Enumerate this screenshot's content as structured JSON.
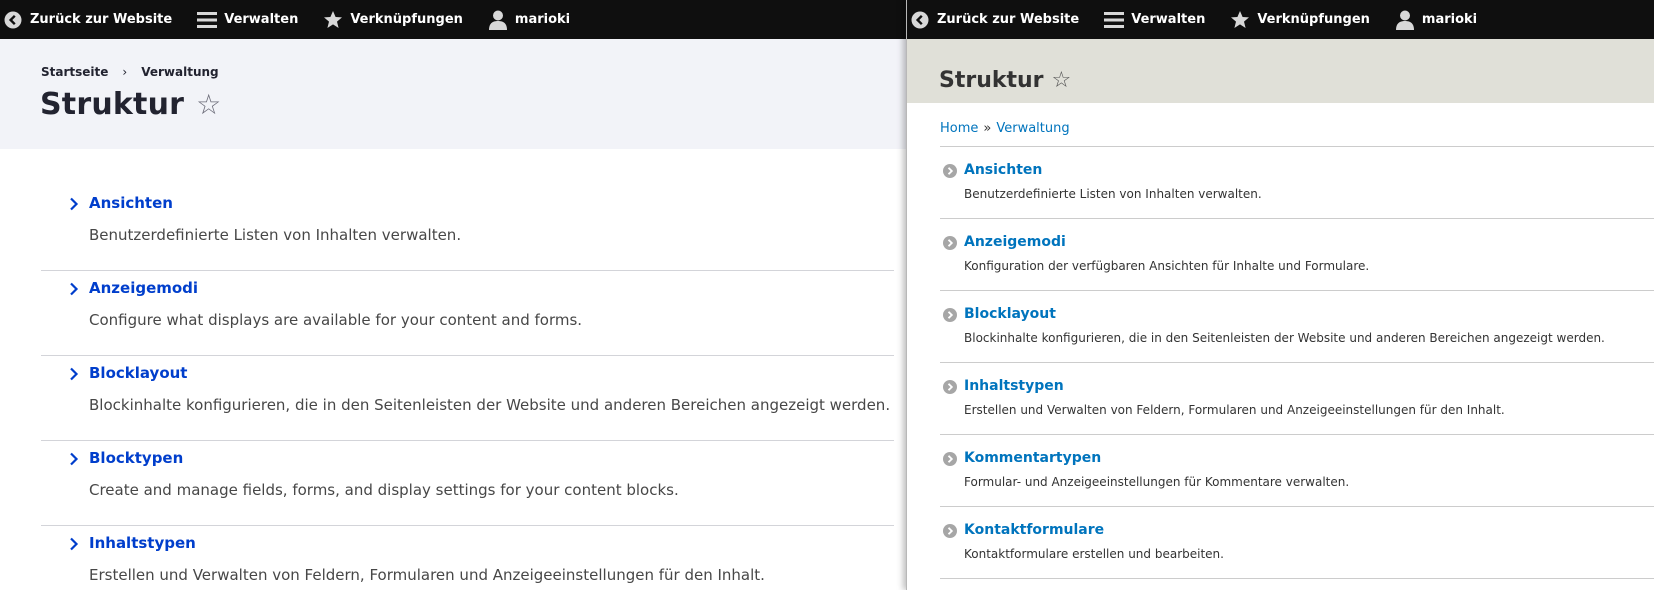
{
  "colors": {
    "toolbar_bg": "#0f0f0f",
    "claro_link": "#003ecc",
    "claro_header_bg": "#f2f3f8",
    "seven_link": "#0074bd",
    "seven_header_bg": "#e0e0d8"
  },
  "toolbar": {
    "items": [
      {
        "label": "Zurück zur Website",
        "icon": "back-arrow-icon"
      },
      {
        "label": "Verwalten",
        "icon": "hamburger-menu-icon"
      },
      {
        "label": "Verknüpfungen",
        "icon": "star-icon"
      },
      {
        "label": "marioki",
        "icon": "user-icon"
      }
    ]
  },
  "left": {
    "breadcrumb": [
      "Startseite",
      "Verwaltung"
    ],
    "breadcrumb_sep": "›",
    "title": "Struktur",
    "star": "☆",
    "items": [
      {
        "label": "Ansichten",
        "desc": "Benutzerdefinierte Listen von Inhalten verwalten."
      },
      {
        "label": "Anzeigemodi",
        "desc": "Configure what displays are available for your content and forms."
      },
      {
        "label": "Blocklayout",
        "desc": "Blockinhalte konfigurieren, die in den Seitenleisten der Website und anderen Bereichen angezeigt werden."
      },
      {
        "label": "Blocktypen",
        "desc": "Create and manage fields, forms, and display settings for your content blocks."
      },
      {
        "label": "Inhaltstypen",
        "desc": "Erstellen und Verwalten von Feldern, Formularen und Anzeigeeinstellungen für den Inhalt."
      }
    ]
  },
  "right": {
    "title": "Struktur",
    "star": "☆",
    "breadcrumb": [
      "Home",
      "Verwaltung"
    ],
    "breadcrumb_sep": "»",
    "items": [
      {
        "label": "Ansichten",
        "desc": "Benutzerdefinierte Listen von Inhalten verwalten."
      },
      {
        "label": "Anzeigemodi",
        "desc": "Konfiguration der verfügbaren Ansichten für Inhalte und Formulare."
      },
      {
        "label": "Blocklayout",
        "desc": "Blockinhalte konfigurieren, die in den Seitenleisten der Website und anderen Bereichen angezeigt werden."
      },
      {
        "label": "Inhaltstypen",
        "desc": "Erstellen und Verwalten von Feldern, Formularen und Anzeigeeinstellungen für den Inhalt."
      },
      {
        "label": "Kommentartypen",
        "desc": "Formular- und Anzeigeeinstellungen für Kommentare verwalten."
      },
      {
        "label": "Kontaktformulare",
        "desc": "Kontaktformulare erstellen und bearbeiten."
      }
    ]
  }
}
